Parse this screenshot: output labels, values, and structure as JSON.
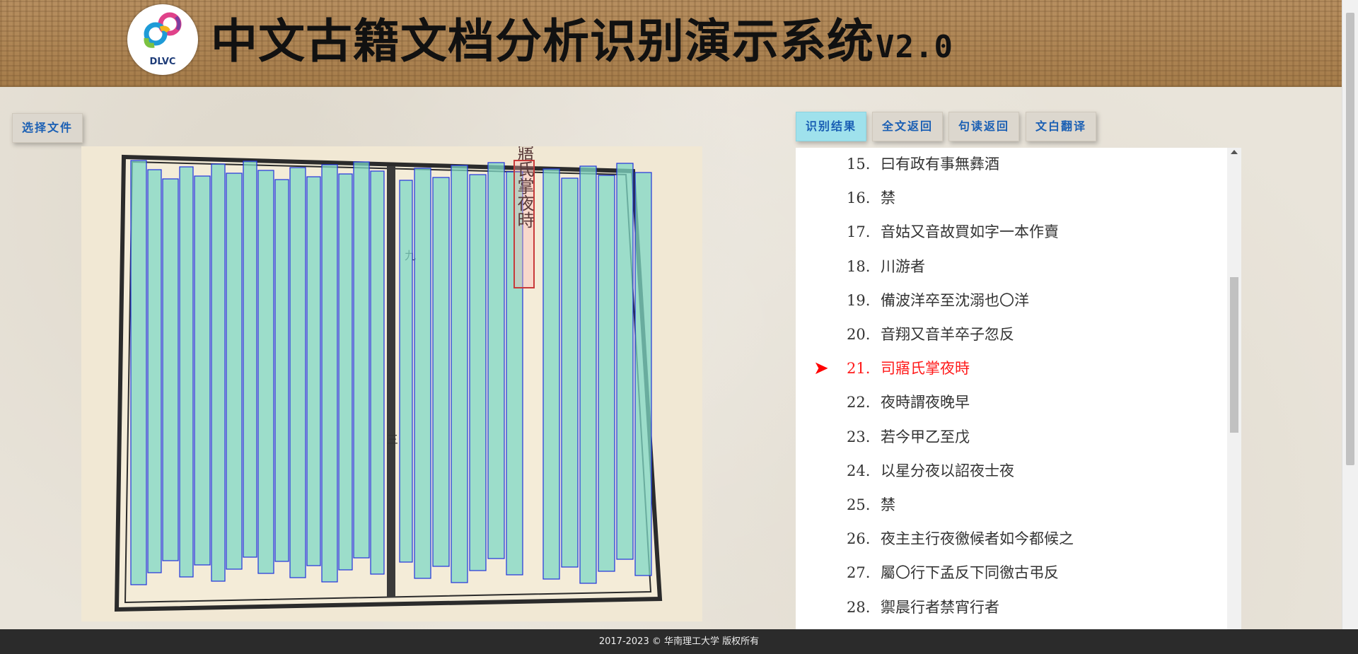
{
  "header": {
    "title": "中文古籍文档分析识别演示系统",
    "version": "V2.0",
    "logo_text": "DLVC"
  },
  "toolbar": {
    "choose_file_label": "选择文件"
  },
  "tabs": [
    {
      "label": "识别结果",
      "active": true
    },
    {
      "label": "全文返回",
      "active": false
    },
    {
      "label": "句读返回",
      "active": false
    },
    {
      "label": "文白翻译",
      "active": false
    }
  ],
  "results": {
    "highlight_index": 21,
    "items": [
      {
        "num": "15.",
        "text": "曰有政有事無彝酒"
      },
      {
        "num": "16.",
        "text": "禁"
      },
      {
        "num": "17.",
        "text": "音姑又音故買如字一本作賣"
      },
      {
        "num": "18.",
        "text": "川游者"
      },
      {
        "num": "19.",
        "text": "備波洋卒至沈溺也〇洋"
      },
      {
        "num": "20.",
        "text": "音翔又音羊卒子忽反"
      },
      {
        "num": "21.",
        "text": "司寤氏掌夜時"
      },
      {
        "num": "22.",
        "text": "夜時謂夜晚早"
      },
      {
        "num": "23.",
        "text": "若今甲乙至戊"
      },
      {
        "num": "24.",
        "text": "以星分夜以詔夜士夜"
      },
      {
        "num": "25.",
        "text": "禁"
      },
      {
        "num": "26.",
        "text": "夜主主行夜徼候者如今都候之"
      },
      {
        "num": "27.",
        "text": "屬〇行下孟反下同徼古弔反"
      },
      {
        "num": "28.",
        "text": "禦晨行者禁宵行者"
      }
    ]
  },
  "document": {
    "recognized_text_column": "司寤氏掌夜時",
    "page_marks": [
      "九",
      "三"
    ]
  },
  "colors": {
    "accent": "#1a5fb4",
    "active_tab": "#9fe1ec",
    "highlight": "#ff1a1a",
    "box_fill": "#7fd8c6",
    "box_stroke": "#2233dd"
  },
  "footer": {
    "copyright": "2017-2023 © 华南理工大学 版权所有"
  }
}
